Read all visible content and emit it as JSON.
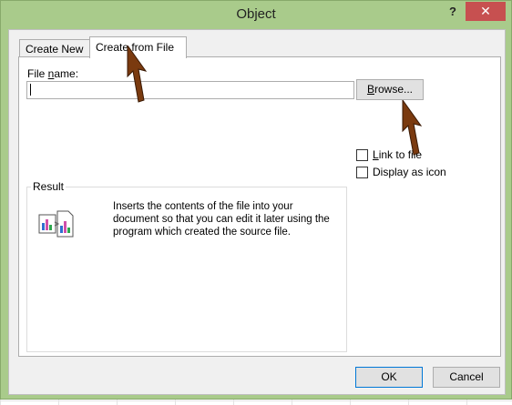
{
  "window": {
    "title": "Object",
    "help_label": "?",
    "close_label": "✕"
  },
  "tabs": [
    {
      "label": "Create New",
      "active": false
    },
    {
      "label": "Create from File",
      "active": true
    }
  ],
  "file_name": {
    "label_pre": "File ",
    "label_access": "n",
    "label_post": "ame:",
    "value": "",
    "placeholder": ""
  },
  "browse": {
    "access": "B",
    "rest": "rowse..."
  },
  "options": [
    {
      "access": "L",
      "rest": "ink to file",
      "checked": false
    },
    {
      "access": "",
      "rest": "Display as icon",
      "checked": false
    }
  ],
  "result": {
    "legend": "Result",
    "text": "Inserts the contents of the file into your document so that you can edit it later using the program which created the source file."
  },
  "footer": {
    "ok_label": "OK",
    "cancel_label": "Cancel"
  },
  "colors": {
    "frame": "#a9cb8b",
    "close_button": "#c75050",
    "annotation_arrow": "#7a3a0f"
  },
  "icons": [
    "close-icon",
    "help-icon",
    "embedded-document-icon",
    "pointer-arrow-icon"
  ]
}
